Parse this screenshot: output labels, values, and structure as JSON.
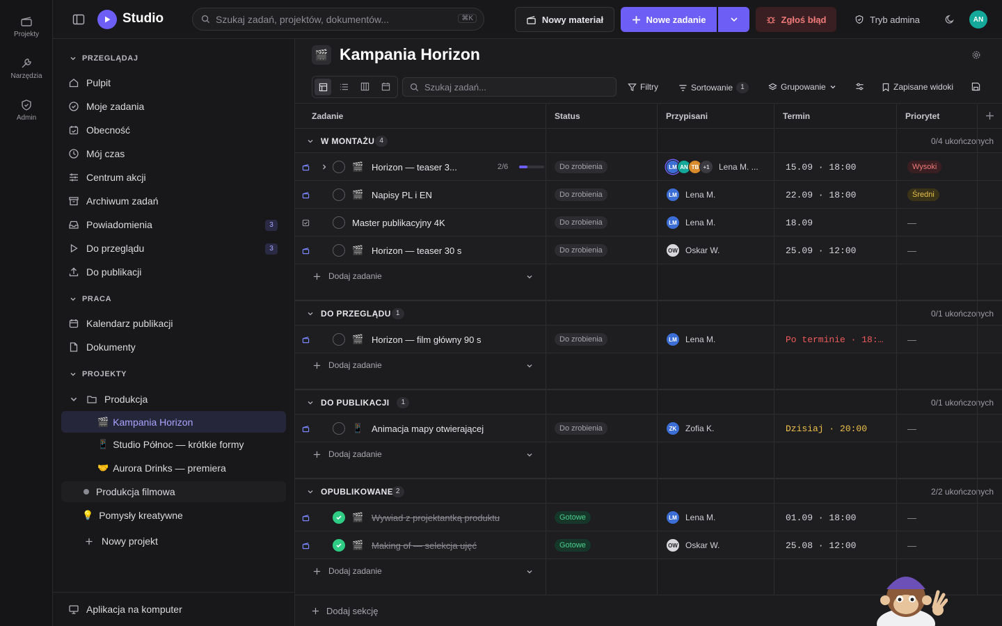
{
  "rail": {
    "items": [
      {
        "label": "Projekty",
        "icon": "film-icon"
      },
      {
        "label": "Narzędzia",
        "icon": "wrench-icon"
      },
      {
        "label": "Admin",
        "icon": "shield-icon"
      }
    ]
  },
  "topbar": {
    "app_name": "Studio",
    "search_placeholder": "Szukaj zadań, projektów, dokumentów...",
    "search_shortcut": "⌘K",
    "new_material": "Nowy materiał",
    "new_task": "Nowe zadanie",
    "report_bug": "Zgłoś błąd",
    "admin_mode": "Tryb admina",
    "user_initials": "AN"
  },
  "sidebar": {
    "browse_title": "PRZEGLĄDAJ",
    "browse": [
      {
        "label": "Pulpit",
        "icon": "home-icon"
      },
      {
        "label": "Moje zadania",
        "icon": "check-circle-icon"
      },
      {
        "label": "Obecność",
        "icon": "calendar-check-icon"
      },
      {
        "label": "Mój czas",
        "icon": "clock-icon"
      },
      {
        "label": "Centrum akcji",
        "icon": "sliders-icon"
      },
      {
        "label": "Archiwum zadań",
        "icon": "archive-icon"
      },
      {
        "label": "Powiadomienia",
        "icon": "inbox-icon",
        "badge": "3"
      },
      {
        "label": "Do przeglądu",
        "icon": "play-icon",
        "badge": "3"
      },
      {
        "label": "Do publikacji",
        "icon": "upload-icon"
      }
    ],
    "work_title": "PRACA",
    "work": [
      {
        "label": "Kalendarz publikacji",
        "icon": "calendar-icon"
      },
      {
        "label": "Dokumenty",
        "icon": "document-icon"
      }
    ],
    "projects_title": "PROJEKTY",
    "folder": "Produkcja",
    "projects": [
      {
        "label": "Kampania Horizon",
        "emoji": "🎬"
      },
      {
        "label": "Studio Północ — krótkie formy",
        "emoji": "📱"
      },
      {
        "label": "Aurora Drinks — premiera",
        "emoji": "🤝"
      }
    ],
    "other": [
      {
        "label": "Produkcja filmowa"
      },
      {
        "label": "Pomysły kreatywne",
        "emoji": "💡"
      },
      {
        "label": "Nowy projekt"
      }
    ],
    "desktop_app": "Aplikacja na komputer"
  },
  "page": {
    "emoji": "🎬",
    "title": "Kampania Horizon",
    "search_placeholder": "Szukaj zadań...",
    "filters": "Filtry",
    "sort": "Sortowanie",
    "sort_count": "1",
    "group": "Grupowanie",
    "saved_views": "Zapisane widoki",
    "columns": [
      "Zadanie",
      "Status",
      "Przypisani",
      "Termin",
      "Priorytet"
    ],
    "add_task": "Dodaj zadanie",
    "add_section": "Dodaj sekcję"
  },
  "groups": [
    {
      "title": "W MONTAŻU",
      "count": "4",
      "done": "0/4 ukończonych",
      "rows": [
        {
          "name": "Horizon — teaser 3...",
          "emoji": "🎬",
          "progress": "2/6",
          "progress_frac": 0.333,
          "status": "Do zrobienia",
          "assignees": [
            "LM",
            "AN",
            "TB"
          ],
          "more": "+1",
          "person": "Lena M. ...",
          "due": "15.09 · 18:00",
          "priority": "Wysoki",
          "expand": true
        },
        {
          "name": "Napisy PL i EN",
          "emoji": "🎬",
          "status": "Do zrobienia",
          "assignees": [
            "LM"
          ],
          "person": "Lena M.",
          "due": "22.09 · 18:00",
          "priority": "Średni"
        },
        {
          "name": "Master publikacyjny 4K",
          "status": "Do zrobienia",
          "assignees": [
            "LM"
          ],
          "person": "Lena M.",
          "due": "18.09",
          "priority": "—"
        },
        {
          "name": "Horizon — teaser 30 s",
          "emoji": "🎬",
          "status": "Do zrobienia",
          "assignees": [
            "OW"
          ],
          "person": "Oskar W.",
          "due": "25.09 · 12:00",
          "priority": "—"
        }
      ]
    },
    {
      "title": "DO PRZEGLĄDU",
      "count": "1",
      "done": "0/1 ukończonych",
      "rows": [
        {
          "name": "Horizon — film główny 90 s",
          "emoji": "🎬",
          "status": "Do zrobienia",
          "assignees": [
            "LM"
          ],
          "person": "Lena M.",
          "due": "Po terminie · 18:…",
          "priority": "—",
          "due_color": "#f05a5a"
        }
      ]
    },
    {
      "title": "DO PUBLIKACJI",
      "count": "1",
      "done": "0/1 ukończonych",
      "rows": [
        {
          "name": "Animacja mapy otwierającej",
          "emoji": "📱",
          "status": "Do zrobienia",
          "assignees": [
            "ZK"
          ],
          "person": "Zofia K.",
          "due": "Dzisiaj · 20:00",
          "priority": "—",
          "due_color": "#f0c24a"
        }
      ]
    },
    {
      "title": "OPUBLIKOWANE",
      "count": "2",
      "done": "2/2 ukończonych",
      "rows": [
        {
          "name": "Wywiad z projektantką produktu",
          "emoji": "🎬",
          "status": "Gotowe",
          "assignees": [
            "LM"
          ],
          "person": "Lena M.",
          "due": "01.09 · 18:00",
          "priority": "—",
          "done": true
        },
        {
          "name": "Making of — selekcja ujęć",
          "emoji": "🎬",
          "status": "Gotowe",
          "assignees": [
            "OW"
          ],
          "person": "Oskar W.",
          "due": "25.08 · 12:00",
          "priority": "—",
          "done": true
        }
      ]
    }
  ],
  "colors": {
    "accent": "#6d5ef5",
    "danger": "#f05a5a",
    "warning": "#f0c24a",
    "success": "#2ecc85"
  }
}
